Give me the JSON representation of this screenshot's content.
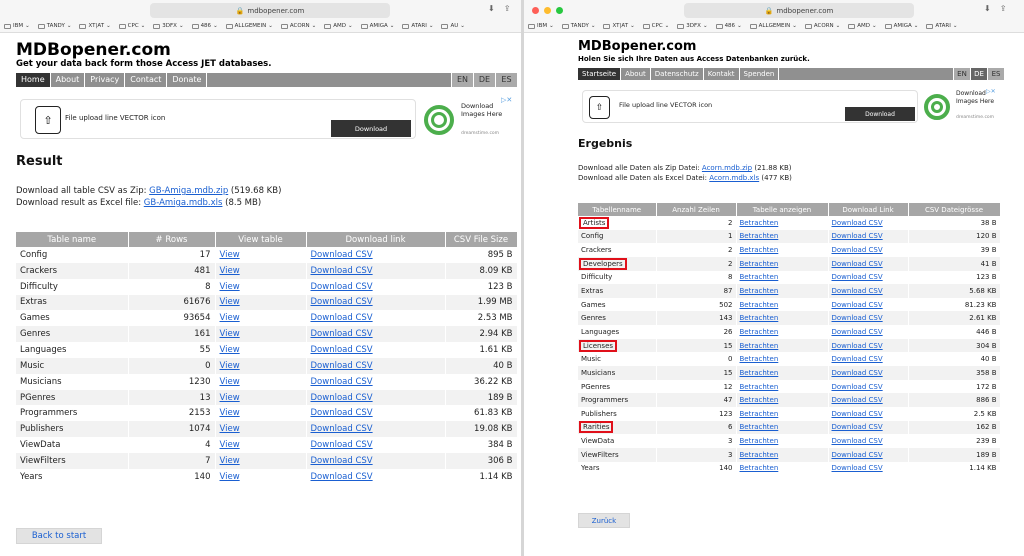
{
  "left": {
    "url": "mdbopener.com",
    "bookmarks": [
      "IBM",
      "TANDY",
      "XT|AT",
      "CPC",
      "3DFX",
      "486",
      "ALLGEMEIN",
      "ACORN",
      "AMD",
      "AMIGA",
      "ATARI",
      "AU"
    ],
    "site_title": "MDBopener.com",
    "site_subtitle": "Get your data back form those Access JET databases.",
    "nav": [
      "Home",
      "About",
      "Privacy",
      "Contact",
      "Donate"
    ],
    "langs": [
      "EN",
      "DE",
      "ES"
    ],
    "ad": {
      "text": "File upload line VECTOR icon",
      "button": "Download",
      "side": "Download Images Here",
      "small": "dreamstime.com"
    },
    "heading": "Result",
    "zip_label": "Download all table CSV as Zip:",
    "zip_link": "GB-Amiga.mdb.zip",
    "zip_size": "(519.68 KB)",
    "xls_label": "Download result as Excel file:",
    "xls_link": "GB-Amiga.mdb.xls",
    "xls_size": "(8.5 MB)",
    "columns": [
      "Table name",
      "# Rows",
      "View table",
      "Download link",
      "CSV File Size"
    ],
    "view_label": "View",
    "download_label": "Download CSV",
    "rows": [
      {
        "name": "Config",
        "rows": "17",
        "size": "895 B"
      },
      {
        "name": "Crackers",
        "rows": "481",
        "size": "8.09 KB"
      },
      {
        "name": "Difficulty",
        "rows": "8",
        "size": "123 B"
      },
      {
        "name": "Extras",
        "rows": "61676",
        "size": "1.99 MB"
      },
      {
        "name": "Games",
        "rows": "93654",
        "size": "2.53 MB"
      },
      {
        "name": "Genres",
        "rows": "161",
        "size": "2.94 KB"
      },
      {
        "name": "Languages",
        "rows": "55",
        "size": "1.61 KB"
      },
      {
        "name": "Music",
        "rows": "0",
        "size": "40 B"
      },
      {
        "name": "Musicians",
        "rows": "1230",
        "size": "36.22 KB"
      },
      {
        "name": "PGenres",
        "rows": "13",
        "size": "189 B"
      },
      {
        "name": "Programmers",
        "rows": "2153",
        "size": "61.83 KB"
      },
      {
        "name": "Publishers",
        "rows": "1074",
        "size": "19.08 KB"
      },
      {
        "name": "ViewData",
        "rows": "4",
        "size": "384 B"
      },
      {
        "name": "ViewFilters",
        "rows": "7",
        "size": "306 B"
      },
      {
        "name": "Years",
        "rows": "140",
        "size": "1.14 KB"
      }
    ],
    "back_button": "Back to start"
  },
  "right": {
    "url": "mdbopener.com",
    "bookmarks": [
      "IBM",
      "TANDY",
      "XT|AT",
      "CPC",
      "3DFX",
      "486",
      "ALLGEMEIN",
      "ACORN",
      "AMD",
      "AMIGA",
      "ATARI"
    ],
    "site_title": "MDBopener.com",
    "site_subtitle": "Holen Sie sich Ihre Daten aus Access Datenbanken zurück.",
    "nav": [
      "Startseite",
      "About",
      "Datenschutz",
      "Kontakt",
      "Spenden"
    ],
    "langs": [
      "EN",
      "DE",
      "ES"
    ],
    "ad": {
      "text": "File upload line VECTOR icon",
      "button": "Download",
      "side": "Download Images Here",
      "small": "dreamstime.com"
    },
    "heading": "Ergebnis",
    "zip_label": "Download alle Daten als Zip Datei:",
    "zip_link": "Acorn.mdb.zip",
    "zip_size": "(21.88 KB)",
    "xls_label": "Download alle Daten als Excel Datei:",
    "xls_link": "Acorn.mdb.xls",
    "xls_size": "(477 KB)",
    "columns": [
      "Tabellenname",
      "Anzahl Zeilen",
      "Tabelle anzeigen",
      "Download Link",
      "CSV Dateigrösse"
    ],
    "view_label": "Betrachten",
    "download_label": "Download CSV",
    "rows": [
      {
        "name": "Artists",
        "rows": "2",
        "size": "38 B",
        "highlight": true
      },
      {
        "name": "Config",
        "rows": "1",
        "size": "120 B"
      },
      {
        "name": "Crackers",
        "rows": "2",
        "size": "39 B"
      },
      {
        "name": "Developers",
        "rows": "2",
        "size": "41 B",
        "highlight": true
      },
      {
        "name": "Difficulty",
        "rows": "8",
        "size": "123 B"
      },
      {
        "name": "Extras",
        "rows": "87",
        "size": "5.68 KB"
      },
      {
        "name": "Games",
        "rows": "502",
        "size": "81.23 KB"
      },
      {
        "name": "Genres",
        "rows": "143",
        "size": "2.61 KB"
      },
      {
        "name": "Languages",
        "rows": "26",
        "size": "446 B"
      },
      {
        "name": "Licenses",
        "rows": "15",
        "size": "304 B",
        "highlight": true
      },
      {
        "name": "Music",
        "rows": "0",
        "size": "40 B"
      },
      {
        "name": "Musicians",
        "rows": "15",
        "size": "358 B"
      },
      {
        "name": "PGenres",
        "rows": "12",
        "size": "172 B"
      },
      {
        "name": "Programmers",
        "rows": "47",
        "size": "886 B"
      },
      {
        "name": "Publishers",
        "rows": "123",
        "size": "2.5 KB"
      },
      {
        "name": "Rarities",
        "rows": "6",
        "size": "162 B",
        "highlight": true
      },
      {
        "name": "ViewData",
        "rows": "3",
        "size": "239 B"
      },
      {
        "name": "ViewFilters",
        "rows": "3",
        "size": "189 B"
      },
      {
        "name": "Years",
        "rows": "140",
        "size": "1.14 KB"
      }
    ],
    "back_button": "Zurück"
  }
}
